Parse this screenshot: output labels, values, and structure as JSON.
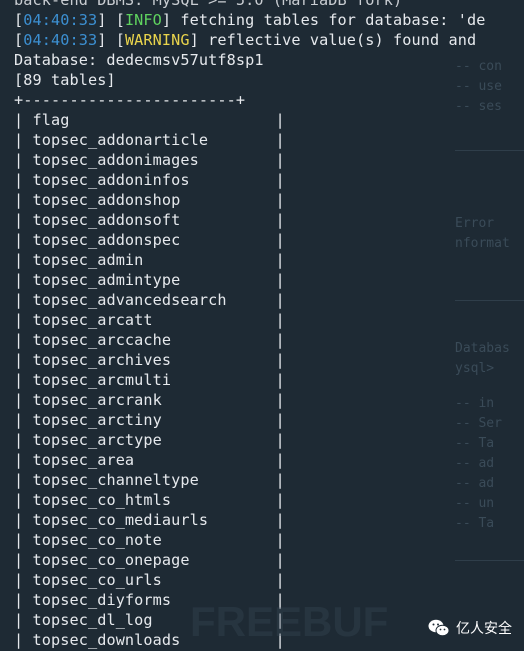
{
  "header": {
    "backend_line": "back-end DBMS: MySQL >= 5.0 (MariaDB fork)",
    "log1": {
      "timestamp": "04:40:33",
      "level": "INFO",
      "message": " fetching tables for database: 'de"
    },
    "log2": {
      "timestamp": "04:40:33",
      "level": "WARNING",
      "message": " reflective value(s) found and"
    },
    "database_line": "Database: dedecmsv57utf8sp1",
    "count_line": "[89 tables]"
  },
  "table": {
    "border_top": "+-----------------------+",
    "tables": [
      "flag",
      "topsec_addonarticle",
      "topsec_addonimages",
      "topsec_addoninfos",
      "topsec_addonshop",
      "topsec_addonsoft",
      "topsec_addonspec",
      "topsec_admin",
      "topsec_admintype",
      "topsec_advancedsearch",
      "topsec_arcatt",
      "topsec_arccache",
      "topsec_archives",
      "topsec_arcmulti",
      "topsec_arcrank",
      "topsec_arctiny",
      "topsec_arctype",
      "topsec_area",
      "topsec_channeltype",
      "topsec_co_htmls",
      "topsec_co_mediaurls",
      "topsec_co_note",
      "topsec_co_onepage",
      "topsec_co_urls",
      "topsec_diyforms",
      "topsec_dl_log",
      "topsec_downloads"
    ]
  },
  "watermark": {
    "text": "FREEBUF"
  },
  "badge": {
    "label": "亿人安全",
    "icon": "wechat-icon"
  },
  "colors": {
    "background": "#1e2a34",
    "timestamp": "#3c8fd1",
    "info": "#5fd35f",
    "warning": "#e9d44c",
    "text": "#e6e9ed"
  }
}
